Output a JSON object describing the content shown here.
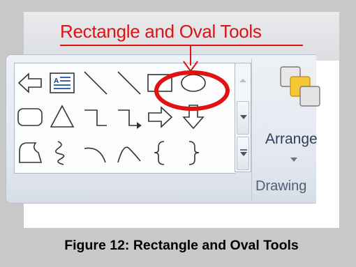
{
  "callout": {
    "text": "Rectangle and  Oval Tools"
  },
  "ribbon": {
    "shapes_gallery": {
      "rows": [
        [
          "left-arrow-icon",
          "text-box-icon",
          "line-icon",
          "arrow-line-icon",
          "rectangle-icon",
          "oval-icon"
        ],
        [
          "rounded-rectangle-icon",
          "triangle-icon",
          "elbow-connector-icon",
          "elbow-arrow-connector-icon",
          "right-arrow-icon",
          "down-arrow-icon"
        ],
        [
          "freeform-icon",
          "scribble-icon",
          "arc-icon",
          "curve-icon",
          "left-brace-icon",
          "right-brace-icon"
        ]
      ]
    },
    "arrange": {
      "label": "Arrange"
    },
    "group_label": "Drawing"
  },
  "caption": {
    "text": "Figure 12: Rectangle and Oval Tools"
  },
  "colors": {
    "callout": "#e01212",
    "ribbon_text": "#2b3f5c",
    "background": "#c8c8c8"
  }
}
